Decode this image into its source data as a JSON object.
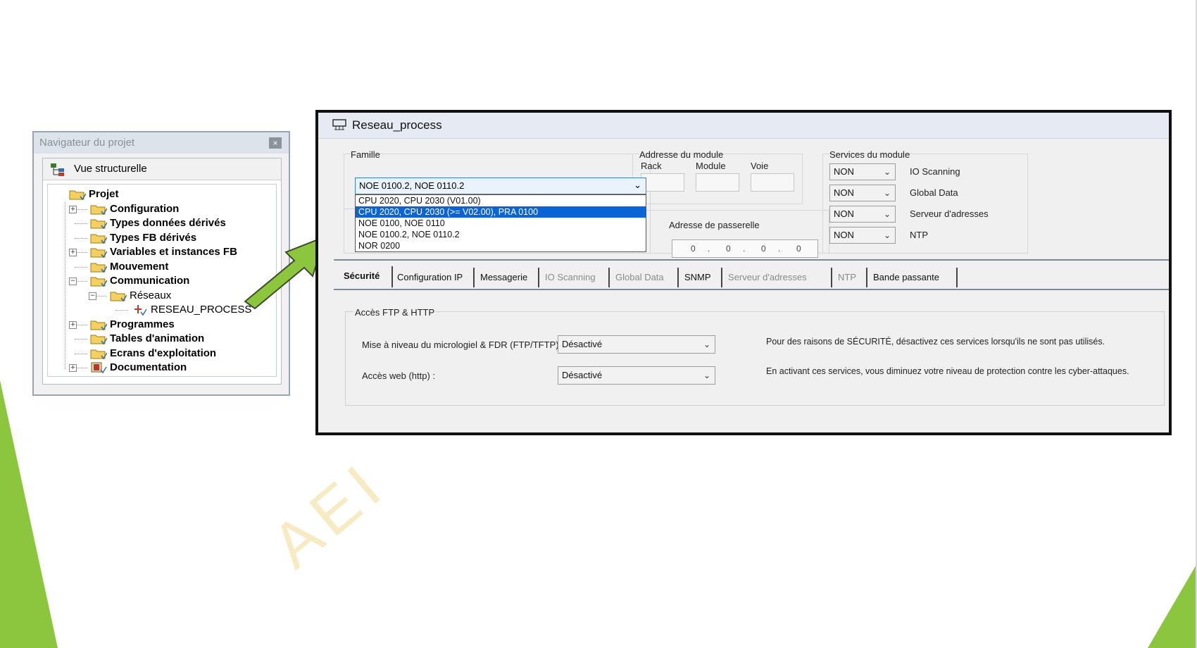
{
  "colors": {
    "accent_green": "#8cc63f",
    "selection_blue": "#0a64d6",
    "window_border": "#111111"
  },
  "watermark": "AEI",
  "navigator": {
    "title": "Navigateur du projet",
    "close_glyph": "×",
    "view_label": "Vue structurelle",
    "tree": [
      {
        "label": "Projet",
        "bold": true,
        "level": 0
      },
      {
        "label": "Configuration",
        "bold": true,
        "level": 1,
        "expander": "+"
      },
      {
        "label": "Types données dérivés",
        "bold": true,
        "level": 1
      },
      {
        "label": "Types FB dérivés",
        "bold": true,
        "level": 1
      },
      {
        "label": "Variables et instances FB",
        "bold": true,
        "level": 1,
        "expander": "+"
      },
      {
        "label": "Mouvement",
        "bold": true,
        "level": 1
      },
      {
        "label": "Communication",
        "bold": true,
        "level": 1,
        "expander": "-"
      },
      {
        "label": "Réseaux",
        "bold": false,
        "level": 2,
        "expander": "-"
      },
      {
        "label": "RESEAU_PROCESS",
        "bold": false,
        "level": 3
      },
      {
        "label": "Programmes",
        "bold": true,
        "level": 1,
        "expander": "+"
      },
      {
        "label": "Tables d'animation",
        "bold": true,
        "level": 1
      },
      {
        "label": "Ecrans d'exploitation",
        "bold": true,
        "level": 1
      },
      {
        "label": "Documentation",
        "bold": true,
        "level": 1,
        "expander": "+"
      }
    ]
  },
  "window": {
    "title": "Reseau_process",
    "famille": {
      "label": "Famille",
      "selected": "NOE 0100.2, NOE 0110.2",
      "options": [
        "CPU 2020, CPU 2030 (V01.00)",
        "CPU 2020, CPU 2030 (>= V02.00), PRA 0100",
        "NOE 0100, NOE 0110",
        "NOE 0100.2, NOE 0110.2",
        "NOR 0200"
      ],
      "highlighted": "CPU 2020, CPU 2030 (>= V02.00), PRA 0100"
    },
    "module_address": {
      "label": "Addresse du module",
      "rack": "Rack",
      "module": "Module",
      "voie": "Voie"
    },
    "gateway": {
      "label": "Adresse de passerelle",
      "octets": [
        "0",
        "0",
        "0",
        "0"
      ],
      "separator": "."
    },
    "services": {
      "label": "Services du module",
      "items": [
        {
          "value": "NON",
          "name": "IO Scanning"
        },
        {
          "value": "NON",
          "name": "Global Data"
        },
        {
          "value": "NON",
          "name": "Serveur d'adresses"
        },
        {
          "value": "NON",
          "name": "NTP"
        }
      ]
    },
    "tabs": [
      {
        "label": "Sécurité",
        "state": "active"
      },
      {
        "label": "Configuration IP",
        "state": "normal"
      },
      {
        "label": "Messagerie",
        "state": "normal"
      },
      {
        "label": "IO Scanning",
        "state": "disabled"
      },
      {
        "label": "Global Data",
        "state": "disabled"
      },
      {
        "label": "SNMP",
        "state": "normal"
      },
      {
        "label": "Serveur d'adresses",
        "state": "disabled"
      },
      {
        "label": "NTP",
        "state": "disabled"
      },
      {
        "label": "Bande passante",
        "state": "normal"
      }
    ],
    "security": {
      "group_label": "Accès FTP & HTTP",
      "firmware_label": "Mise à niveau du micrologiel & FDR (FTP/TFTP):",
      "firmware_value": "Désactivé",
      "web_label": "Accès web (http) :",
      "web_value": "Désactivé",
      "note1": "Pour des raisons de SÉCURITÉ, désactivez ces services lorsqu'ils ne sont pas utilisés.",
      "note2": "En activant ces services, vous diminuez votre niveau de protection contre les cyber-attaques."
    }
  }
}
